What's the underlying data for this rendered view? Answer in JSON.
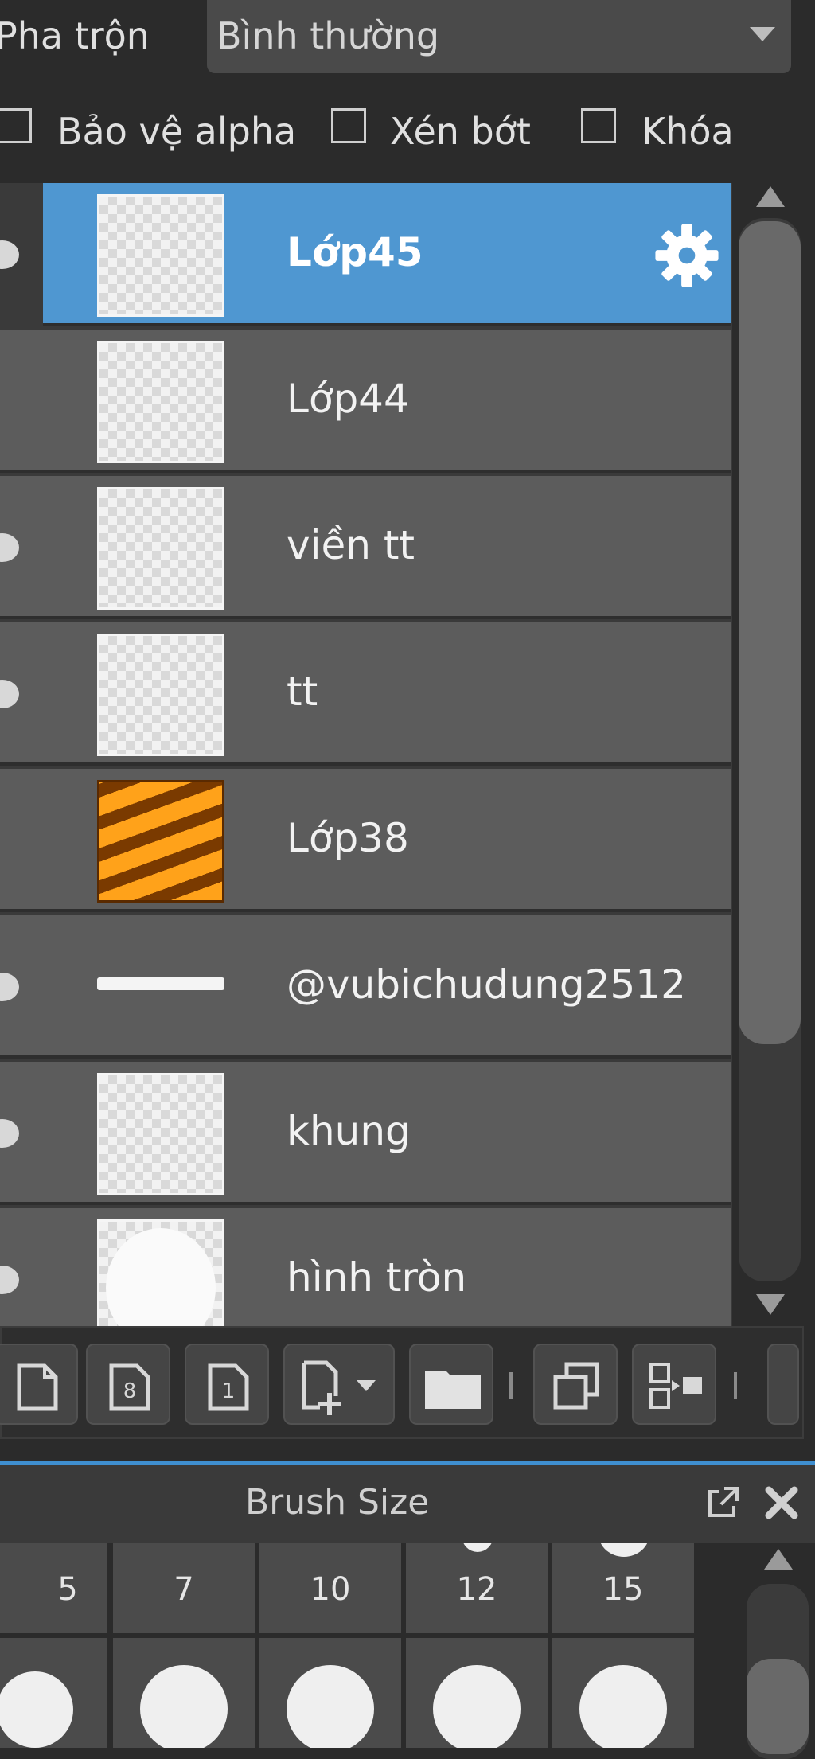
{
  "blend": {
    "label": "Pha trộn",
    "value": "Bình thường"
  },
  "options": [
    {
      "label": "Bảo vệ alpha",
      "checked": false
    },
    {
      "label": "Xén bớt",
      "checked": false
    },
    {
      "label": "Khóa",
      "checked": false
    }
  ],
  "layers": [
    {
      "name": "Lớp45",
      "selected": true,
      "visible": true,
      "thumb": "transparent"
    },
    {
      "name": "Lớp44",
      "selected": false,
      "visible": false,
      "thumb": "transparent"
    },
    {
      "name": "viền tt",
      "selected": false,
      "visible": true,
      "thumb": "transparent"
    },
    {
      "name": "tt",
      "selected": false,
      "visible": true,
      "thumb": "transparent"
    },
    {
      "name": "Lớp38",
      "selected": false,
      "visible": false,
      "thumb": "orange-stripes"
    },
    {
      "name": "@vubichudung2512",
      "selected": false,
      "visible": true,
      "thumb": "white-line"
    },
    {
      "name": "khung",
      "selected": false,
      "visible": true,
      "thumb": "transparent"
    },
    {
      "name": "hình tròn",
      "selected": false,
      "visible": true,
      "thumb": "white-circle"
    }
  ],
  "toolbar": {
    "buttons": [
      "new-layer-icon",
      "new-8bit-layer-icon",
      "new-1bit-layer-icon",
      "add-layer-dropdown-icon",
      "folder-icon",
      "duplicate-layer-icon",
      "merge-layer-icon",
      "more-icon"
    ]
  },
  "brush_panel": {
    "title": "Brush Size",
    "sizes": [
      "5",
      "7",
      "10",
      "12",
      "15"
    ]
  },
  "colors": {
    "selected": "#4f97d1",
    "row": "#5c5c5c",
    "accent": "#3f8fd0"
  }
}
